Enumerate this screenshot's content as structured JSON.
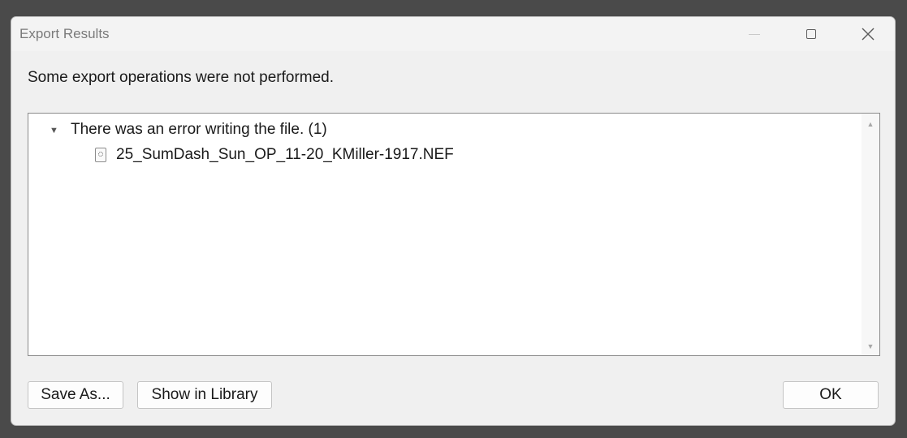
{
  "window": {
    "title": "Export Results"
  },
  "message": "Some export operations were not performed.",
  "results": {
    "group_label": "There was an error writing the file. (1)",
    "expanded": true,
    "files": [
      "25_SumDash_Sun_OP_11-20_KMiller-1917.NEF"
    ]
  },
  "buttons": {
    "save_as": "Save As...",
    "show_in_library": "Show in Library",
    "ok": "OK"
  },
  "icons": {
    "expand": "triangle-down-icon",
    "file": "raw-file-icon",
    "minimize": "minimize-icon",
    "maximize": "maximize-icon",
    "close": "close-icon"
  }
}
